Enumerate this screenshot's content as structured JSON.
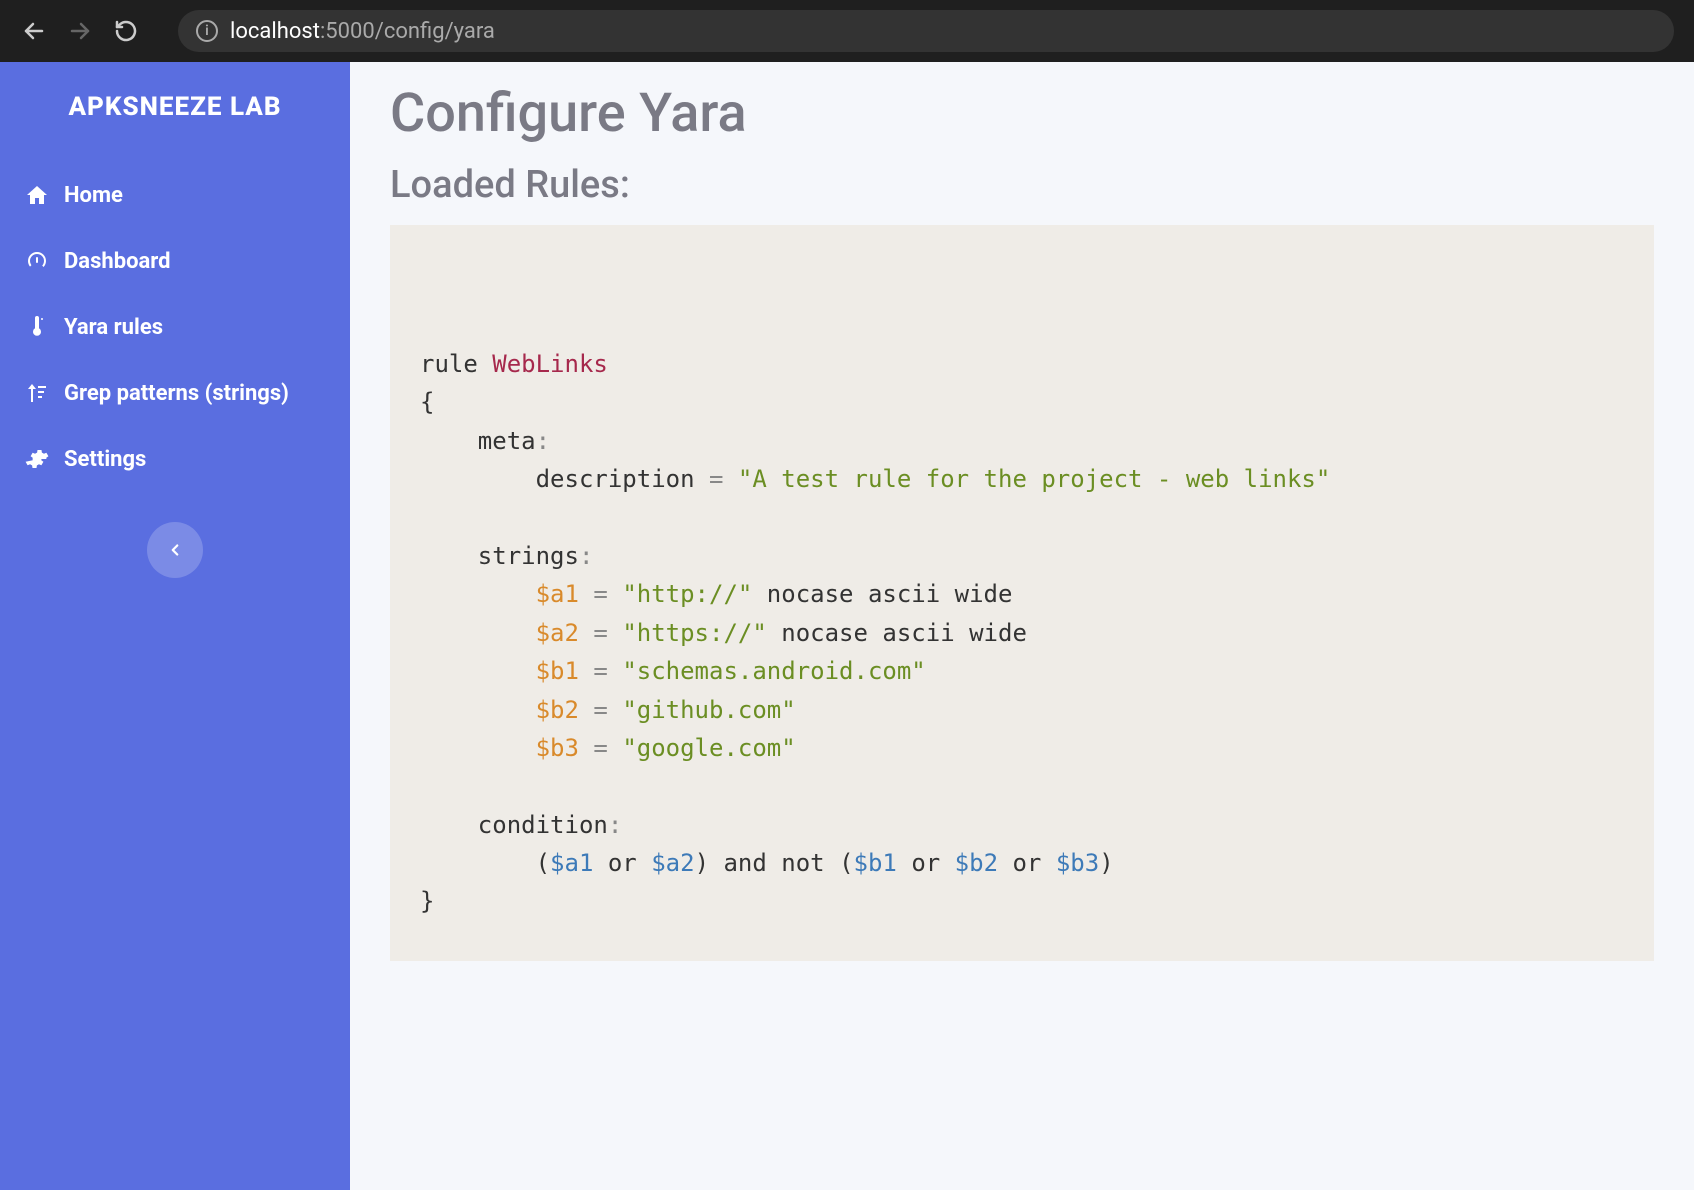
{
  "browser": {
    "url_host": "localhost",
    "url_path": ":5000/config/yara"
  },
  "sidebar": {
    "brand": "APKSNEEZE LAB",
    "items": [
      {
        "icon": "home-icon",
        "label": "Home"
      },
      {
        "icon": "dashboard-icon",
        "label": "Dashboard"
      },
      {
        "icon": "thermometer-icon",
        "label": "Yara rules"
      },
      {
        "icon": "sort-icon",
        "label": "Grep patterns (strings)"
      },
      {
        "icon": "gear-icon",
        "label": "Settings"
      }
    ]
  },
  "main": {
    "title": "Configure Yara",
    "subtitle": "Loaded Rules:",
    "rule": {
      "keyword_rule": "rule",
      "name": "WebLinks",
      "brace_open": "{",
      "brace_close": "}",
      "meta_kw": "meta",
      "colon": ":",
      "description_key": "description",
      "eq": "=",
      "description_val": "\"A test rule for the project - web links\"",
      "strings_kw": "strings",
      "strings": [
        {
          "var": "$a1",
          "val": "\"http://\"",
          "mod": " nocase ascii wide"
        },
        {
          "var": "$a2",
          "val": "\"https://\"",
          "mod": " nocase ascii wide"
        },
        {
          "var": "$b1",
          "val": "\"schemas.android.com\"",
          "mod": ""
        },
        {
          "var": "$b2",
          "val": "\"github.com\"",
          "mod": ""
        },
        {
          "var": "$b3",
          "val": "\"google.com\"",
          "mod": ""
        }
      ],
      "condition_kw": "condition",
      "cond_open": "(",
      "cond_a1": "$a1",
      "cond_or1": " or ",
      "cond_a2": "$a2",
      "cond_close1": ")",
      "cond_and_not": " and not ",
      "cond_open2": "(",
      "cond_b1": "$b1",
      "cond_or2": " or ",
      "cond_b2": "$b2",
      "cond_or3": " or ",
      "cond_b3": "$b3",
      "cond_close2": ")"
    }
  }
}
